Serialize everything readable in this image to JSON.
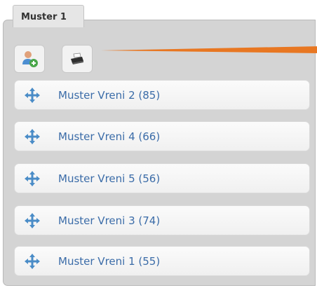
{
  "tab": {
    "label": "Muster 1"
  },
  "toolbar": {
    "add_user_icon": "add-user-icon",
    "print_icon": "print-icon"
  },
  "colors": {
    "accent_line": "#e87722",
    "item_text": "#3b6ca8",
    "move_icon": "#4a8cc7"
  },
  "items": [
    {
      "label": "Muster Vreni 2 (85)"
    },
    {
      "label": "Muster Vreni 4 (66)"
    },
    {
      "label": "Muster Vreni 5 (56)"
    },
    {
      "label": "Muster Vreni 3 (74)"
    },
    {
      "label": "Muster Vreni 1 (55)"
    }
  ]
}
